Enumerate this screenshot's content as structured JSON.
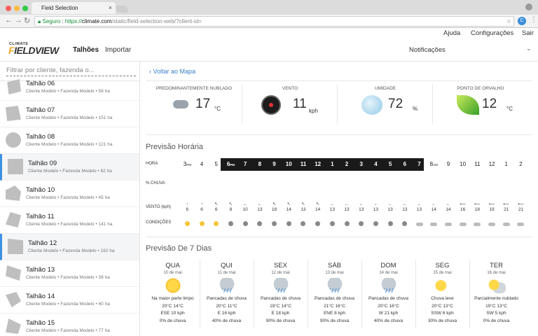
{
  "browser": {
    "tab_title": "Field Selection",
    "close_glyph": "×",
    "secure_label": "Seguro",
    "url_scheme": "https://",
    "url_host": "climate.com",
    "url_path": "/static/field-selection-web/?client-id=",
    "extension_initial": "C"
  },
  "topnav": {
    "help": "Ajuda",
    "settings": "Configurações",
    "logout": "Sair"
  },
  "header": {
    "logo_small": "CLIMATE",
    "logo_first": "F",
    "logo_rest": "IELDVIEW",
    "nav_fields": "Talhões",
    "nav_import": "Importar",
    "notifications": "Notificações"
  },
  "sidebar": {
    "filter_placeholder": "Filtrar por cliente, fazenda o...",
    "fields": [
      {
        "name": "Talhão 06",
        "sub": "Cliente Modelo • Fazenda Modelo • 58 ha"
      },
      {
        "name": "Talhão 07",
        "sub": "Cliente Modelo • Fazenda Modelo • 151 ha"
      },
      {
        "name": "Talhão 08",
        "sub": "Cliente Modelo • Fazenda Modelo • 121 ha"
      },
      {
        "name": "Talhão 09",
        "sub": "Cliente Modelo • Fazenda Modelo • 82 ha",
        "selected": true
      },
      {
        "name": "Talhão 10",
        "sub": "Cliente Modelo • Fazenda Modelo • 45 ha"
      },
      {
        "name": "Talhão 11",
        "sub": "Cliente Modelo • Fazenda Modelo • 141 ha"
      },
      {
        "name": "Talhão 12",
        "sub": "Cliente Modelo • Fazenda Modelo • 192 ha",
        "selected": true
      },
      {
        "name": "Talhão 13",
        "sub": "Cliente Modelo • Fazenda Modelo • 39 ha"
      },
      {
        "name": "Talhão 14",
        "sub": "Cliente Modelo • Fazenda Modelo • 60 ha"
      },
      {
        "name": "Talhão 15",
        "sub": "Cliente Modelo • Fazenda Modelo • 77 ha"
      }
    ]
  },
  "main": {
    "back_link": "‹ Voltar ao Mapa",
    "current": [
      {
        "label": "Predominantemente nublado",
        "value": "17",
        "unit": "°C",
        "icon": "cloud-icon"
      },
      {
        "label": "Vento",
        "value": "11",
        "unit": "kph",
        "icon": "wind-dial-icon"
      },
      {
        "label": "Umidade",
        "value": "72",
        "unit": "%",
        "icon": "humidity-drops-icon"
      },
      {
        "label": "Ponto de orvalho",
        "value": "12",
        "unit": "°C",
        "icon": "leaf-icon"
      }
    ],
    "hourly_title": "Previsão Horária",
    "hourly_labels": {
      "hour": "HORA",
      "rain": "% CHUVA",
      "wind": "VENTO (kph)",
      "conditions": "CONDIÇÕES"
    },
    "hours": [
      {
        "h": "3",
        "suffix": "PM"
      },
      {
        "h": "4"
      },
      {
        "h": "5"
      },
      {
        "h": "6",
        "suffix": "PM"
      },
      {
        "h": "7"
      },
      {
        "h": "8"
      },
      {
        "h": "9"
      },
      {
        "h": "10"
      },
      {
        "h": "11"
      },
      {
        "h": "12"
      },
      {
        "h": "1"
      },
      {
        "h": "2"
      },
      {
        "h": "3"
      },
      {
        "h": "4"
      },
      {
        "h": "5"
      },
      {
        "h": "6"
      },
      {
        "h": "7"
      },
      {
        "h": "8",
        "suffix": "AM"
      },
      {
        "h": "9"
      },
      {
        "h": "10"
      },
      {
        "h": "11"
      },
      {
        "h": "12"
      },
      {
        "h": "1"
      },
      {
        "h": "2"
      }
    ],
    "wind_values": [
      "6",
      "6",
      "6",
      "8",
      "10",
      "13",
      "18",
      "14",
      "13",
      "14",
      "13",
      "13",
      "13",
      "13",
      "13",
      "13",
      "13",
      "14",
      "14",
      "16",
      "18",
      "19",
      "21",
      "21"
    ],
    "wind_arrows": [
      "↑",
      "↑",
      "↖",
      "↖",
      "←",
      "←",
      "↖",
      "↖",
      "↖",
      "↖",
      "←",
      "←",
      "←",
      "←",
      "←",
      "←",
      "←",
      "←",
      "←",
      "⟵",
      "⟵",
      "⟵",
      "⟵",
      "⟵"
    ],
    "conditions": [
      "sun",
      "sun",
      "sun",
      "moon",
      "moon",
      "moon",
      "moon",
      "moon",
      "moon",
      "moon",
      "moon",
      "moon",
      "moon",
      "moon",
      "moon",
      "moon",
      "cloud",
      "cloud",
      "cloud",
      "cloud",
      "cloud",
      "cloud",
      "cloud",
      "cloud"
    ],
    "daily_title": "Previsão De 7 Dias",
    "days": [
      {
        "name": "QUA",
        "date": "10 de mai",
        "desc": "Na maior parte limpo",
        "temps": "20°C 14°C",
        "wind": "ESE 10 kph",
        "rain": "0% de chuva",
        "icon": "sun-icon"
      },
      {
        "name": "QUI",
        "date": "11 de mai",
        "desc": "Pancadas de chuva",
        "temps": "20°C 11°C",
        "wind": "E 16 kph",
        "rain": "40% de chuva",
        "icon": "rain-cloud-icon"
      },
      {
        "name": "SEX",
        "date": "12 de mai",
        "desc": "Pancadas de chuva",
        "temps": "19°C 14°C",
        "wind": "E 18 kph",
        "rain": "90% de chuva",
        "icon": "rain-cloud-icon"
      },
      {
        "name": "SÁB",
        "date": "13 de mai",
        "desc": "Pancadas de chuva",
        "temps": "21°C 16°C",
        "wind": "ENE 8 kph",
        "rain": "90% de chuva",
        "icon": "rain-cloud-icon"
      },
      {
        "name": "DOM",
        "date": "14 de mai",
        "desc": "Pancadas de chuva",
        "temps": "20°C 16°C",
        "wind": "W 21 kph",
        "rain": "40% de chuva",
        "icon": "rain-cloud-icon"
      },
      {
        "name": "SEG",
        "date": "15 de mai",
        "desc": "Chuva leve",
        "temps": "20°C 13°C",
        "wind": "SSW 6 kph",
        "rain": "30% de chuva",
        "icon": "moon-icon"
      },
      {
        "name": "TER",
        "date": "16 de mai",
        "desc": "Parcialmente nublado",
        "temps": "19°C 13°C",
        "wind": "SW 5 kph",
        "rain": "0% de chuva",
        "icon": "partly-cloudy-icon"
      }
    ]
  }
}
